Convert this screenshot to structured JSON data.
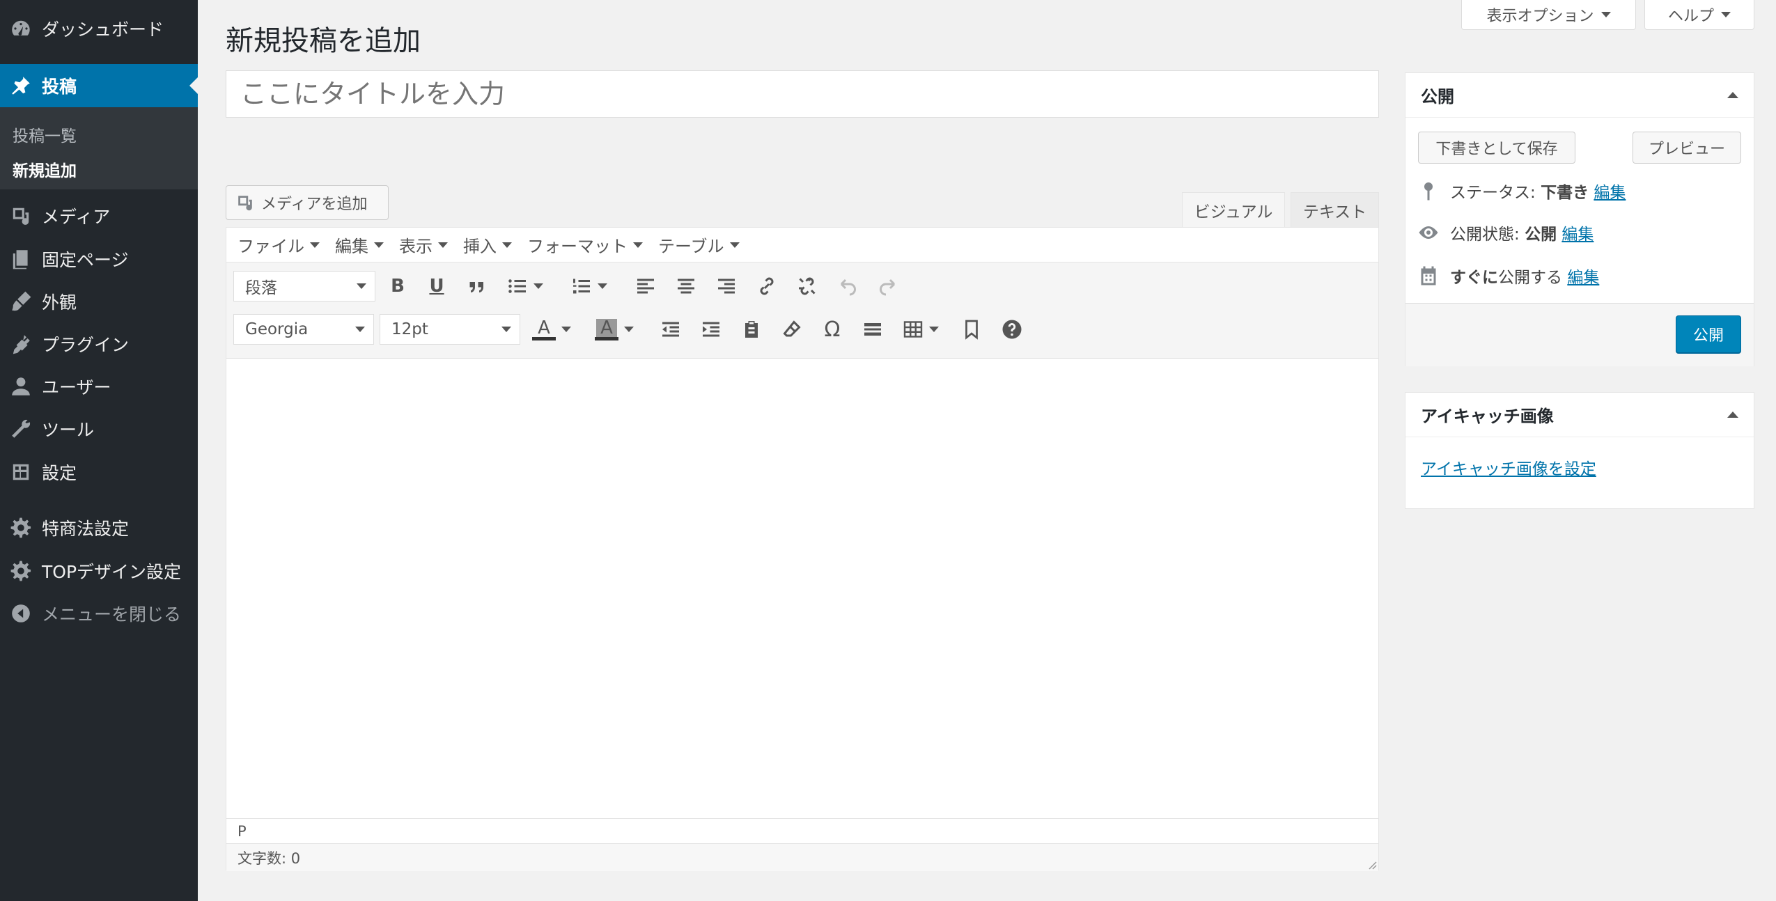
{
  "sidebar": {
    "items": [
      {
        "label": "ダッシュボード",
        "icon": "dashboard-icon"
      },
      {
        "label": "投稿",
        "icon": "pin-icon"
      },
      {
        "label": "メディア",
        "icon": "media-icon"
      },
      {
        "label": "固定ページ",
        "icon": "page-icon"
      },
      {
        "label": "外観",
        "icon": "brush-icon"
      },
      {
        "label": "プラグイン",
        "icon": "plugin-icon"
      },
      {
        "label": "ユーザー",
        "icon": "user-icon"
      },
      {
        "label": "ツール",
        "icon": "wrench-icon"
      },
      {
        "label": "設定",
        "icon": "settings-icon"
      },
      {
        "label": "特商法設定",
        "icon": "gear-icon"
      },
      {
        "label": "TOPデザイン設定",
        "icon": "gear-icon"
      },
      {
        "label": "メニューを閉じる",
        "icon": "collapse-icon"
      }
    ],
    "submenu": [
      "投稿一覧",
      "新規追加"
    ]
  },
  "top_buttons": {
    "screen_options": "表示オプション",
    "help": "ヘルプ"
  },
  "page_title": "新規投稿を追加",
  "title_placeholder": "ここにタイトルを入力",
  "media_button": "メディアを追加",
  "editor_tabs": {
    "visual": "ビジュアル",
    "text": "テキスト"
  },
  "menubar": [
    "ファイル",
    "編集",
    "表示",
    "挿入",
    "フォーマット",
    "テーブル"
  ],
  "toolbar": {
    "format_select": "段落",
    "font_select": "Georgia",
    "size_select": "12pt",
    "bold": "B",
    "underline": "U",
    "text_color": "A",
    "bg_color": "A",
    "omega": "Ω"
  },
  "path": "P",
  "word_count": "文字数: 0",
  "publish_box": {
    "title": "公開",
    "save_draft": "下書きとして保存",
    "preview": "プレビュー",
    "status_label": "ステータス:",
    "status_value": "下書き",
    "visibility_label": "公開状態:",
    "visibility_value": "公開",
    "schedule_bold": "すぐに",
    "schedule_rest": "公開する",
    "edit": "編集",
    "publish": "公開"
  },
  "featured_box": {
    "title": "アイキャッチ画像",
    "link": "アイキャッチ画像を設定"
  },
  "colors": {
    "accent": "#0073aa",
    "sidebar": "#23282d",
    "publish": "#0085ba"
  }
}
